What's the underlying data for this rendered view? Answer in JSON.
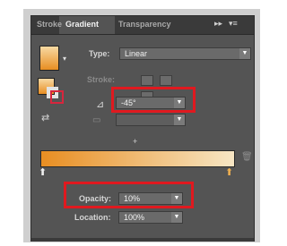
{
  "tabs": {
    "stroke": "Stroke",
    "gradient": "Gradient",
    "transparency": "Transparency",
    "expand": "▸▸",
    "menu": "▾≡"
  },
  "gradient": {
    "type_label": "Type:",
    "type_value": "Linear",
    "stroke_label": "Stroke:",
    "angle_value": "-45°",
    "aspect_value": "",
    "opacity_label": "Opacity:",
    "opacity_value": "10%",
    "location_label": "Location:",
    "location_value": "100%"
  },
  "icons": {
    "angle": "angle-icon",
    "aspect": "aspect-ratio-icon",
    "reverse": "reverse-gradient-icon",
    "trash": "trash-icon"
  },
  "colors": {
    "gradient_start": "#e88e22",
    "gradient_end": "#f7e6c4",
    "highlight": "#e0191f"
  }
}
